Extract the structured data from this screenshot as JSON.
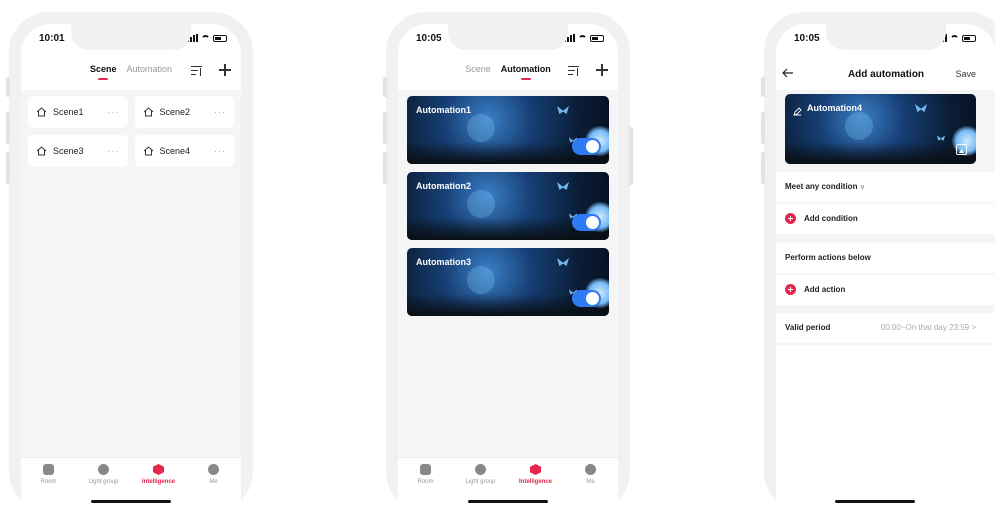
{
  "phone1": {
    "time": "10:01",
    "tabs": {
      "scene": "Scene",
      "automation": "Automation"
    },
    "scenes": [
      {
        "name": "Scene1"
      },
      {
        "name": "Scene2"
      },
      {
        "name": "Scene3"
      },
      {
        "name": "Scene4"
      }
    ],
    "more": "···"
  },
  "phone2": {
    "time": "10:05",
    "tabs": {
      "scene": "Scene",
      "automation": "Automation"
    },
    "automations": [
      {
        "title": "Automation1",
        "enabled": true
      },
      {
        "title": "Automation2",
        "enabled": true
      },
      {
        "title": "Automation3",
        "enabled": true
      }
    ]
  },
  "tabbar": {
    "items": [
      {
        "label": "Room",
        "icon": "door-icon"
      },
      {
        "label": "Light group",
        "icon": "light-group-icon"
      },
      {
        "label": "Intelligence",
        "icon": "intelligence-icon",
        "active": true
      },
      {
        "label": "Me",
        "icon": "profile-icon"
      }
    ]
  },
  "phone3": {
    "time": "10:05",
    "title": "Add automation",
    "save": "Save",
    "cover_title": "Automation4",
    "condition_header": "Meet any condition",
    "chevron": "v",
    "add_condition": "Add condition",
    "actions_header": "Perform actions below",
    "add_action": "Add action",
    "valid_label": "Valid period",
    "valid_value": "00:00~On that day 23:59",
    "valid_chevron": ">"
  },
  "colors": {
    "accent": "#e6264c",
    "toggle": "#2f7bf5",
    "background": "#f5f5f5"
  }
}
